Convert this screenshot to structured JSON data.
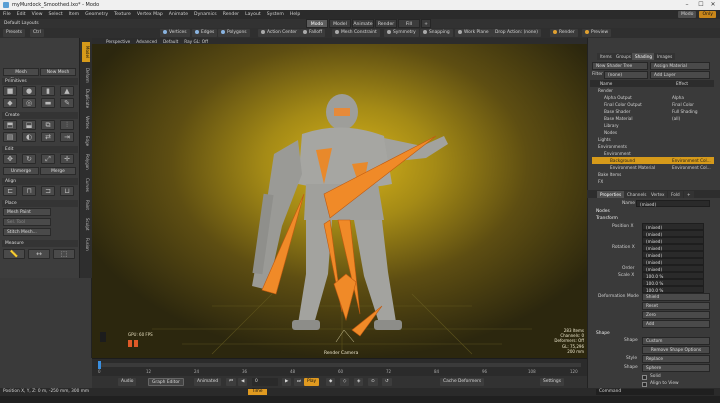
{
  "window": {
    "title": "myMurdock_Smoothed.lxo* - Modo",
    "controls": [
      "–",
      "☐",
      "✕"
    ]
  },
  "menu": {
    "items": [
      "File",
      "Edit",
      "View",
      "Select",
      "Item",
      "Geometry",
      "Texture",
      "Vertex Map",
      "Animate",
      "Dynamics",
      "Render",
      "Layout",
      "System",
      "Help"
    ],
    "right": [
      "Modo",
      "Only"
    ]
  },
  "layout": {
    "name": "Default Layouts",
    "tabs": [
      "Modo",
      "Model",
      "Animate",
      "Render",
      "Fill",
      "+"
    ]
  },
  "toolbar": {
    "left": [
      "Presets",
      "Ctrl"
    ],
    "center": [
      "Vertices",
      "Edges",
      "Polygons",
      "Action Center",
      "Falloff",
      "Mesh Constraint",
      "Symmetry",
      "Snapping",
      "Work Plane"
    ],
    "right": [
      "Drop Action: (none)",
      "Render",
      "Preview"
    ]
  },
  "left_toolbox": {
    "top_tabs": [
      "Mesh Cleanup...",
      "New Mesh"
    ],
    "sections": {
      "primitives": "Primitives",
      "create": "Create",
      "edit": "Edit",
      "align": "Align",
      "place": "Place",
      "measure": "Measure"
    },
    "edit_buttons": [
      "Unmerge",
      "Merge"
    ],
    "place_buttons": [
      "Mesh Paint",
      "Sel. Tool",
      "Stitch Mesh..."
    ],
    "vertical_tabs": [
      "Model",
      "Deform",
      "Duplicate",
      "Vertex",
      "Edge",
      "Polygon",
      "Curves",
      "Paint",
      "Sculpt",
      "Fusion"
    ]
  },
  "viewport": {
    "header": [
      "Perspective",
      "Advanced",
      "Default",
      "Ray GL: Off"
    ],
    "camera_label": "Render Camera",
    "overlay_left": "GPU: 60 FPS",
    "stats": [
      "283 Items",
      "Channels: 0",
      "Deformers: Off",
      "GL: 75,296",
      "200 mm"
    ]
  },
  "timeline": {
    "ticks": [
      "0",
      "12",
      "24",
      "36",
      "48",
      "60",
      "72",
      "84",
      "96",
      "108",
      "120"
    ]
  },
  "transport": {
    "audio": "Audio",
    "graph_editor": "Graph Editor",
    "animated": "Animated",
    "frame": "0",
    "play": "Play",
    "cache_deformers": "Cache Deformers",
    "settings": "Settings"
  },
  "status": {
    "position": "Position X, Y, Z:  0 m, -250 mm, 300 mm",
    "time_label": "Time",
    "command": "Command"
  },
  "shader": {
    "tabs": [
      "Items",
      "Groups",
      "Shading",
      "Images"
    ],
    "new_label": "New Shader Tree",
    "filter_label": "Filter",
    "filter_value": "(none)",
    "assign_label": "Assign Material",
    "add_layer": "Add Layer",
    "col_name": "Name",
    "col_effect": "Effect",
    "rows": [
      {
        "name": "Render",
        "effect": ""
      },
      {
        "name": "Alpha Output",
        "effect": "Alpha"
      },
      {
        "name": "Final Color Output",
        "effect": "Final Color"
      },
      {
        "name": "Base Shader",
        "effect": "Full Shading"
      },
      {
        "name": "Base Material",
        "effect": "(all)"
      },
      {
        "name": "Library",
        "effect": ""
      },
      {
        "name": "Nodes",
        "effect": ""
      },
      {
        "name": "Lights",
        "effect": ""
      },
      {
        "name": "Environments",
        "effect": ""
      },
      {
        "name": "Environment",
        "effect": ""
      },
      {
        "name": "Background",
        "effect": "Environment Col..."
      },
      {
        "name": "Environment Material",
        "effect": "Environment Col..."
      },
      {
        "name": "Bake Items",
        "effect": ""
      },
      {
        "name": "FX",
        "effect": ""
      }
    ]
  },
  "properties": {
    "tabs": [
      "Properties",
      "Channels",
      "Vertex",
      "Fold",
      "+"
    ],
    "name_label": "Name",
    "name_value": "(mixed)",
    "sections": [
      "Nodes",
      "Transform",
      "Shape"
    ],
    "position_label": "Position X",
    "position_values": [
      "(mixed)",
      "(mixed)",
      "(mixed)"
    ],
    "rotation_label": "Rotation X",
    "rotation_values": [
      "(mixed)",
      "(mixed)",
      "(mixed)"
    ],
    "order_label": "Order",
    "order_value": "(mixed)",
    "scale_label": "Scale X",
    "scale_values": [
      "100.0 %",
      "100.0 %",
      "100.0 %"
    ],
    "deform_label": "Deformation Mode",
    "deform_value": "Shield",
    "reset": "Reset",
    "zero": "Zero",
    "add": "Add",
    "shape_label": "Shape",
    "shape_value": "Custom",
    "remove_shape": "Remove Shape Options",
    "style_label": "Style",
    "style_value": "Replace",
    "shape2_label": "Shape",
    "shape2_value": "Sphere",
    "solid": "Solid",
    "align_view": "Align to View"
  }
}
